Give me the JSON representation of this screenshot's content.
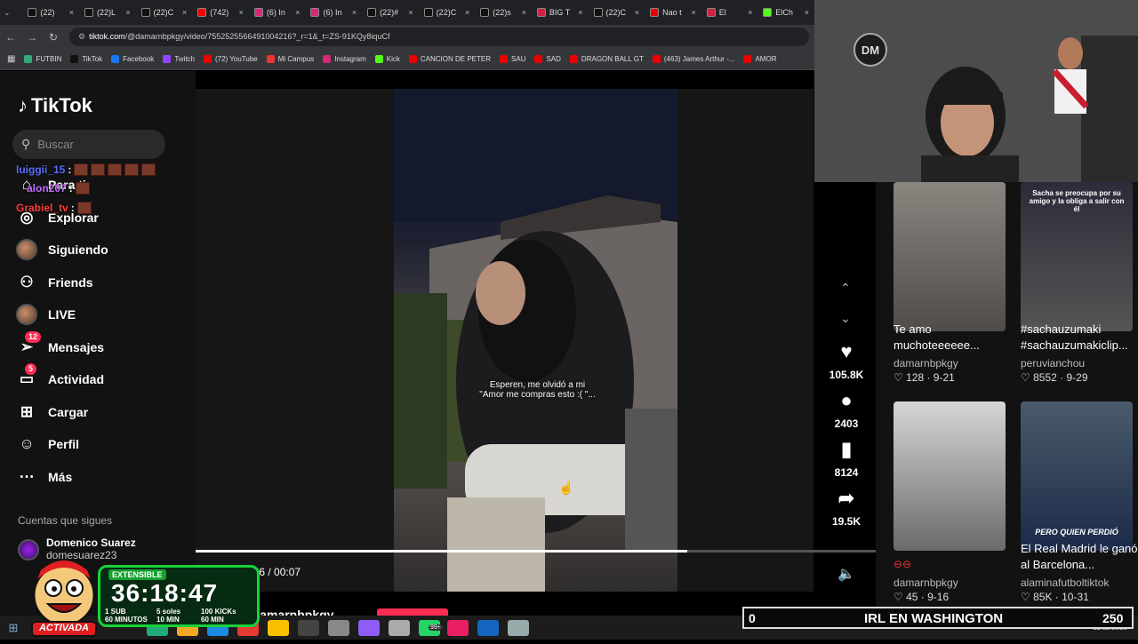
{
  "tabs": [
    {
      "label": "(22)",
      "icon": "tiktok-icon"
    },
    {
      "label": "(22)L",
      "icon": "tiktok-icon"
    },
    {
      "label": "(22)C",
      "icon": "tiktok-icon"
    },
    {
      "label": "(742)",
      "icon": "youtube-icon"
    },
    {
      "label": "(6) In",
      "icon": "instagram-icon"
    },
    {
      "label": "(6) In",
      "icon": "instagram-icon"
    },
    {
      "label": "(22)#",
      "icon": "tiktok-icon"
    },
    {
      "label": "(22)C",
      "icon": "tiktok-icon"
    },
    {
      "label": "(22)s",
      "icon": "tiktok-icon"
    },
    {
      "label": "BIG T",
      "icon": "app-icon"
    },
    {
      "label": "(22)C",
      "icon": "tiktok-icon"
    },
    {
      "label": "Nao t",
      "icon": "youtube-icon"
    },
    {
      "label": "El",
      "icon": "app-icon"
    },
    {
      "label": "ElCh",
      "icon": "kick-icon"
    }
  ],
  "url": {
    "host": "tiktok.com",
    "path": "/@damarnbpkgy/video/7552525566491004216?_r=1&_t=ZS-91KQy8iquCf"
  },
  "bookmarks": [
    "FUTBIN",
    "TikTok",
    "Facebook",
    "Twitch",
    "(72) YouTube",
    "Mi Campus",
    "Instagram",
    "Kick",
    "CANCION DE PETER",
    "SAU",
    "SAD",
    "DRAGON BALL GT",
    "(463) James Arthur -...",
    "AMOR"
  ],
  "sidebar": {
    "logo": "TikTok",
    "search_placeholder": "Buscar",
    "items": [
      {
        "label": "Para ti",
        "icon": "home-icon"
      },
      {
        "label": "Explorar",
        "icon": "compass-icon"
      },
      {
        "label": "Siguiendo",
        "icon": "avatar"
      },
      {
        "label": "Friends",
        "icon": "friends-icon"
      },
      {
        "label": "LIVE",
        "icon": "avatar"
      },
      {
        "label": "Mensajes",
        "icon": "send-icon",
        "badge": "12"
      },
      {
        "label": "Actividad",
        "icon": "message-icon",
        "badge": "5"
      },
      {
        "label": "Cargar",
        "icon": "plus-icon"
      },
      {
        "label": "Perfil",
        "icon": "profile-icon"
      },
      {
        "label": "Más",
        "icon": "more-icon"
      }
    ],
    "following_title": "Cuentas que sigues",
    "following": [
      {
        "name": "Domenico Suarez",
        "handle": "domesuarez23"
      }
    ]
  },
  "chat": [
    {
      "user": "luiggii_15",
      "color": "#5b6cff"
    },
    {
      "user": "alon207",
      "color": "#c46bff"
    },
    {
      "user": "Grabiel_tv",
      "color": "#ff3b3b"
    }
  ],
  "video": {
    "caption_line1": "Esperen, me olvidó a mi",
    "caption_line2": "\"Amor me compras esto :( \"...",
    "time": "00:06 / 00:07",
    "progress": 0.85,
    "author": "@damarnbpkgy"
  },
  "actions": [
    {
      "icon": "heart-icon",
      "count": "105.8K"
    },
    {
      "icon": "comment-icon",
      "count": "2403"
    },
    {
      "icon": "bookmark-icon",
      "count": "8124"
    },
    {
      "icon": "share-icon",
      "count": "19.5K"
    }
  ],
  "related": [
    {
      "title": "Te amo muchoteeeeee...",
      "author": "damarnbpkgy",
      "likes": "128",
      "date": "9-21"
    },
    {
      "title": "#sachauzumaki #sachauzumakiclip...",
      "author": "peruvianchou",
      "likes": "8552",
      "date": "9-29",
      "overlay": "Sacha se preocupa por su amigo y la obliga a salir con él"
    },
    {
      "title": "",
      "author": "damarnbpkgy",
      "likes": "45",
      "date": "9-16"
    },
    {
      "title": "El Real Madrid le ganó al Barcelona...",
      "author": "alaminafutboltiktok",
      "likes": "85K",
      "date": "10-31",
      "overlay": "PERO QUIEN PERDIÓ"
    }
  ],
  "overlay": {
    "timer_label": "EXTENSIBLE",
    "timer": "36:18:47",
    "sub_info": "1 SUB",
    "sub_time": "60 MINUTOS",
    "sol_info": "5 soles",
    "sol_time": "10 MIN",
    "kick_info": "100 KICKs",
    "kick_time": "60 MIN",
    "mascot_text": "ACTIVADA",
    "goal_left": "0",
    "goal_title": "IRL EN WASHINGTON",
    "goal_right": "250"
  },
  "taskbar": {
    "date": "11/11/2025",
    "badge": "99+"
  }
}
